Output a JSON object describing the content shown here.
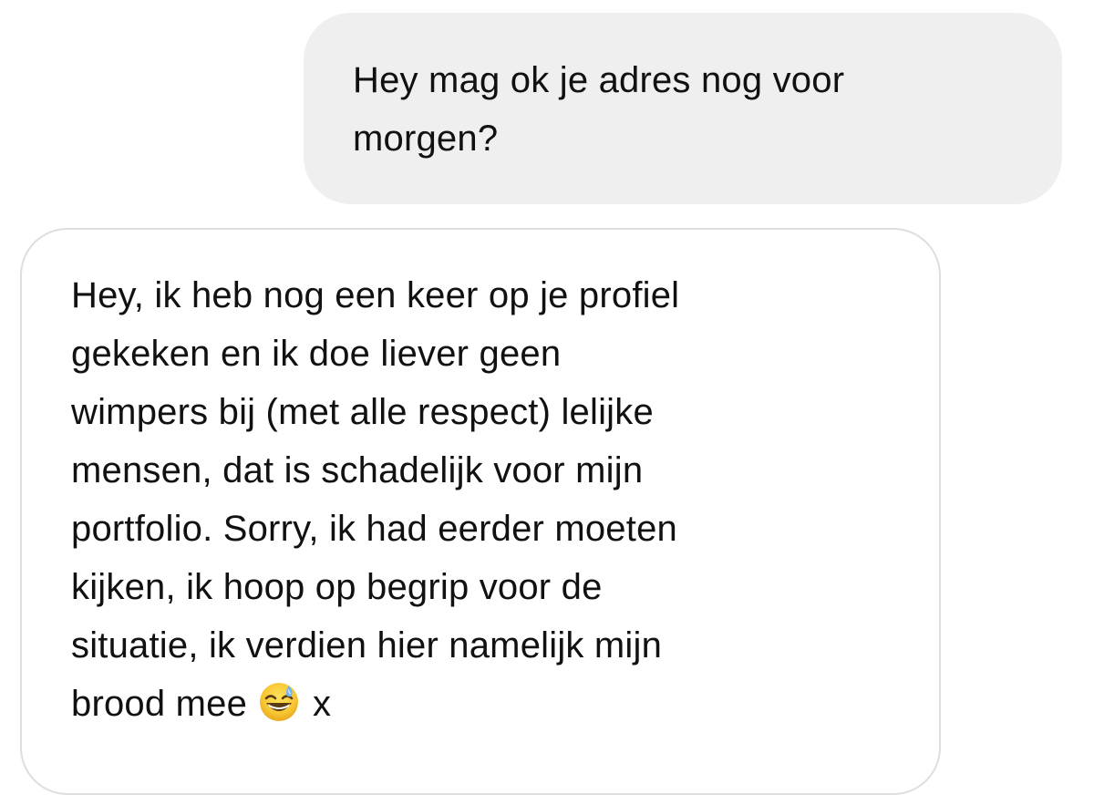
{
  "conversation": {
    "sent_message": {
      "lines": [
        "Hey mag ok je adres nog voor",
        "morgen?"
      ]
    },
    "received_message": {
      "lines": [
        "Hey, ik heb nog een keer op je profiel",
        "gekeken en ik doe liever geen",
        "wimpers bij (met alle respect) lelijke",
        "mensen, dat is schadelijk voor mijn",
        "portfolio. Sorry, ik had eerder moeten",
        "kijken, ik hoop op begrip voor de",
        "situatie, ik verdien hier namelijk mijn"
      ],
      "last_line_text": "brood mee",
      "last_line_suffix": "x",
      "emoji": "grinning-face-with-sweat-emoji"
    }
  },
  "colors": {
    "sent_bubble": "#efefef",
    "received_bubble_border": "#dedede",
    "text": "#111111",
    "emoji_face": "#f7c531",
    "emoji_sweat": "#6fb6ff"
  }
}
